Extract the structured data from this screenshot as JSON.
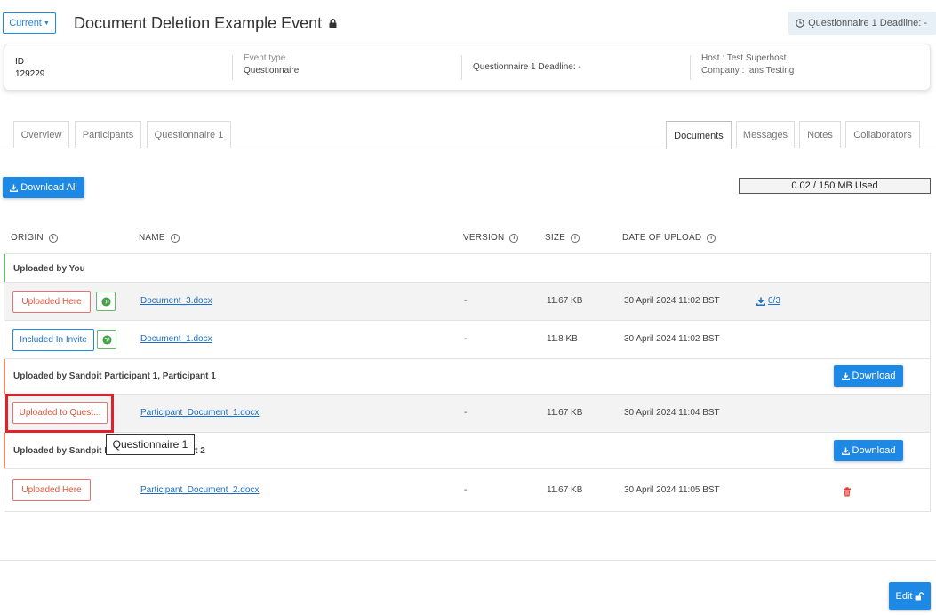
{
  "header": {
    "current_label": "Current",
    "title": "Document Deletion Example Event",
    "deadline_badge": "Questionnaire 1 Deadline: -"
  },
  "info": {
    "id_label": "ID",
    "id_value": "129229",
    "event_type_label": "Event type",
    "event_type_value": "Questionnaire",
    "deadline": "Questionnaire 1 Deadline: -",
    "host": "Host : Test Superhost",
    "company": "Company : Ians Testing"
  },
  "tabs": {
    "left": [
      "Overview",
      "Participants",
      "Questionnaire 1"
    ],
    "right": [
      "Documents",
      "Messages",
      "Notes",
      "Collaborators"
    ],
    "active": "Documents"
  },
  "toolbar": {
    "download_all": "Download All",
    "storage_used": "0.02 / 150 MB Used"
  },
  "columns": {
    "origin": "ORIGIN",
    "name": "NAME",
    "version": "VERSION",
    "size": "SIZE",
    "date": "DATE OF UPLOAD"
  },
  "groups": [
    {
      "label": "Uploaded by You",
      "rows": [
        {
          "origin": "Uploaded Here",
          "name": "Document_3.docx",
          "version": "-",
          "size": "11.67 KB",
          "date": "30 April 2024 11:02 BST",
          "downloads": "0/3"
        },
        {
          "origin": "Included In Invite",
          "name": "Document_1.docx",
          "version": "-",
          "size": "11.8 KB",
          "date": "30 April 2024 11:02 BST"
        }
      ]
    },
    {
      "label": "Uploaded by Sandpit Participant 1, Participant 1",
      "download": "Download",
      "rows": [
        {
          "origin": "Uploaded to Quest...",
          "name": "Participant_Document_1.docx",
          "version": "-",
          "size": "11.67 KB",
          "date": "30 April 2024 11:04 BST"
        }
      ]
    },
    {
      "label_visible_start": "Uploaded by Sandpit P",
      "label_visible_end": "nt 2",
      "download": "Download",
      "rows": [
        {
          "origin": "Uploaded Here",
          "name": "Participant_Document_2.docx",
          "version": "-",
          "size": "11.67 KB",
          "date": "30 April 2024 11:05 BST"
        }
      ]
    }
  ],
  "tooltip": "Questionnaire 1",
  "footer": {
    "edit_label": "Edit"
  },
  "colors": {
    "primary": "#1e88e5",
    "danger": "#e0553c",
    "group_you": "#66bb6a",
    "group_participant": "#f0895a",
    "highlight": "#e0202a"
  }
}
